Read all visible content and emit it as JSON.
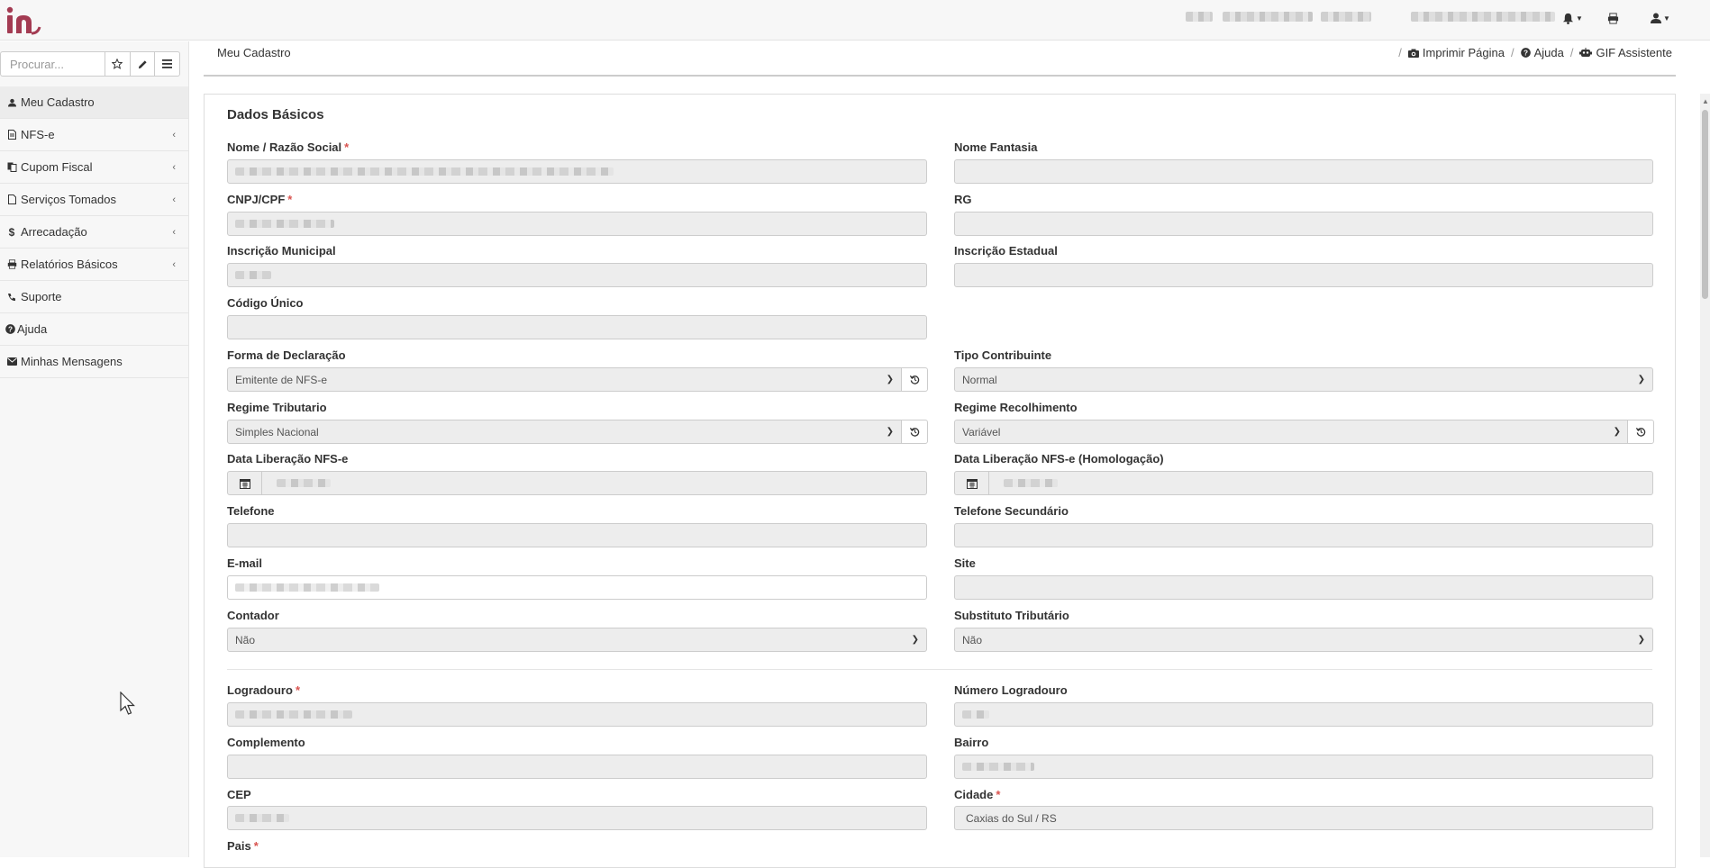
{
  "brand": {
    "logo_text": "in",
    "accent": "#a33b52"
  },
  "topbar": {
    "icons": [
      "bell-icon",
      "print-icon",
      "user-icon"
    ]
  },
  "sidebar": {
    "search_placeholder": "Procurar...",
    "tool_icons": [
      "star-icon",
      "pencil-icon",
      "menu-icon"
    ],
    "items": [
      {
        "label": "Meu Cadastro",
        "icon": "user-icon",
        "expandable": false,
        "active": true
      },
      {
        "label": "NFS-e",
        "icon": "document-icon",
        "expandable": true
      },
      {
        "label": "Cupom Fiscal",
        "icon": "copy-icon",
        "expandable": true
      },
      {
        "label": "Serviços Tomados",
        "icon": "file-icon",
        "expandable": true
      },
      {
        "label": "Arrecadação",
        "icon": "dollar-icon",
        "expandable": true
      },
      {
        "label": "Relatórios Básicos",
        "icon": "print-icon",
        "expandable": true
      },
      {
        "label": "Suporte",
        "icon": "phone-icon",
        "expandable": false
      },
      {
        "label": "Ajuda",
        "icon": "question-icon",
        "expandable": false
      },
      {
        "label": "Minhas Mensagens",
        "icon": "envelope-icon",
        "expandable": false
      }
    ]
  },
  "header": {
    "page_title": "Meu Cadastro",
    "actions": [
      {
        "label": "Imprimir Página",
        "icon": "camera-icon"
      },
      {
        "label": "Ajuda",
        "icon": "question-icon"
      },
      {
        "label": "GIF Assistente",
        "icon": "robot-icon"
      }
    ]
  },
  "form": {
    "title": "Dados Básicos",
    "nome_razao_social": {
      "label": "Nome / Razão Social",
      "required": "*"
    },
    "nome_fantasia": {
      "label": "Nome Fantasia"
    },
    "cnpj_cpf": {
      "label": "CNPJ/CPF",
      "required": "*"
    },
    "rg": {
      "label": "RG"
    },
    "inscricao_municipal": {
      "label": "Inscrição Municipal"
    },
    "inscricao_estadual": {
      "label": "Inscrição Estadual"
    },
    "codigo_unico": {
      "label": "Código Único"
    },
    "forma_declaracao": {
      "label": "Forma de Declaração",
      "value": "Emitente de NFS-e"
    },
    "tipo_contribuinte": {
      "label": "Tipo Contribuinte",
      "value": "Normal"
    },
    "regime_tributario": {
      "label": "Regime Tributario",
      "value": "Simples Nacional"
    },
    "regime_recolhimento": {
      "label": "Regime Recolhimento",
      "value": "Variável"
    },
    "data_liberacao": {
      "label": "Data Liberação NFS-e"
    },
    "data_liberacao_homolog": {
      "label": "Data Liberação NFS-e (Homologação)"
    },
    "telefone": {
      "label": "Telefone"
    },
    "telefone_secundario": {
      "label": "Telefone Secundário"
    },
    "email": {
      "label": "E-mail"
    },
    "site": {
      "label": "Site"
    },
    "contador": {
      "label": "Contador",
      "value": "Não"
    },
    "substituto_tributario": {
      "label": "Substituto Tributário",
      "value": "Não"
    },
    "logradouro": {
      "label": "Logradouro",
      "required": "*"
    },
    "numero_logradouro": {
      "label": "Número Logradouro"
    },
    "complemento": {
      "label": "Complemento"
    },
    "bairro": {
      "label": "Bairro"
    },
    "cep": {
      "label": "CEP"
    },
    "cidade": {
      "label": "Cidade",
      "required": "*",
      "value": "Caxias do Sul / RS"
    },
    "pais": {
      "label": "Pais",
      "required": "*"
    }
  }
}
